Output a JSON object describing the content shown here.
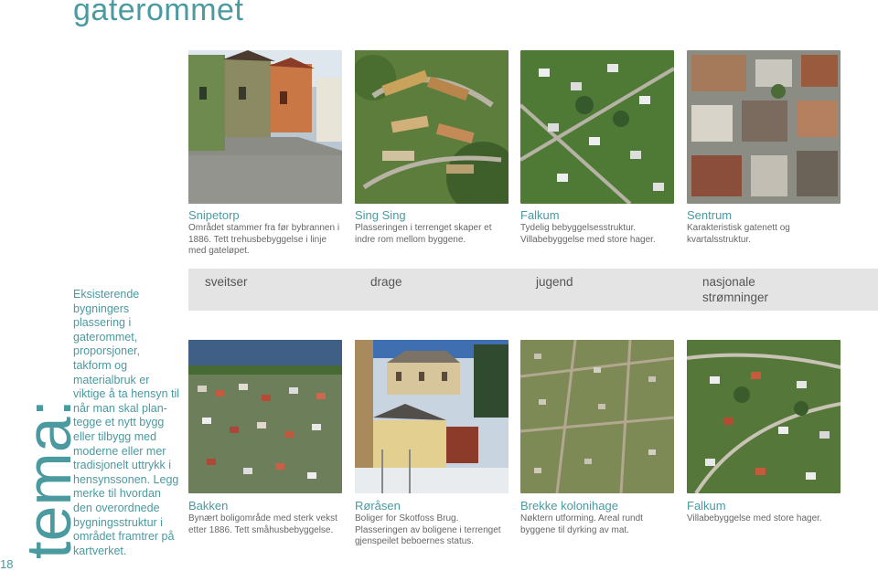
{
  "page": {
    "title": "gaterommet",
    "page_number": "18",
    "theme_word": "tema:",
    "side_text": "Eksisterende bygningers plassering i gaterommet, proporsjoner, takform og materialbruk er viktige å ta hensyn til når man skal plan-tegge et nytt bygg eller tilbygg med moderne eller mer tradisjonelt uttrykk i hensynssonen. Legg merke til hvordan den overordnede bygningsstruktur i området framtrer på kartverket."
  },
  "top_row": [
    {
      "heading": "Snipetorp",
      "text": "Området stammer fra før bybrannen i 1886. Tett trehusbebyggelse i linje med gateløpet."
    },
    {
      "heading": "Sing Sing",
      "text": "Plasseringen i terrenget skaper et indre rom mellom byggene."
    },
    {
      "heading": "Falkum",
      "text": "Tydelig bebyggelsesstruktur. Villabebyggelse med store hager."
    },
    {
      "heading": "Sentrum",
      "text": "Karakteristisk gatenett og kvartalsstruktur."
    }
  ],
  "band_labels": [
    "sveitser",
    "drage",
    "jugend",
    "nasjonale strømninger"
  ],
  "bottom_row": [
    {
      "heading": "Bakken",
      "text": "Bynært boligområde med sterk vekst etter 1886. Tett småhusbebyggelse."
    },
    {
      "heading": "Røråsen",
      "text": "Boliger for Skotfoss Brug. Plasseringen av boligene i terrenget gjenspeilet beboernes status."
    },
    {
      "heading": "Brekke kolonihage",
      "text": "Nøktern utforming. Areal rundt byggene til dyrking av mat."
    },
    {
      "heading": "Falkum",
      "text": "Villabebyggelse med store hager."
    }
  ]
}
